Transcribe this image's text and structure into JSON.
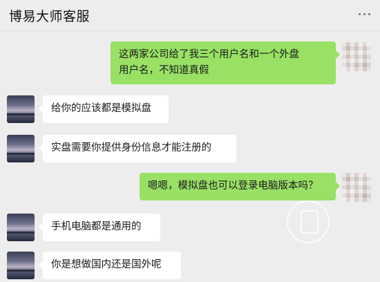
{
  "header": {
    "title": "博易大师客服",
    "more_icon": "ellipsis-icon"
  },
  "messages": [
    {
      "side": "out",
      "lines": [
        "这两家公司给了我三个用户名和一个外盘",
        "用户名，不知道真假"
      ]
    },
    {
      "side": "in",
      "text": "给你的应该都是模拟盘"
    },
    {
      "side": "in",
      "text": "实盘需要你提供身份信息才能注册的"
    },
    {
      "side": "out",
      "text": "嗯嗯，模拟盘也可以登录电脑版本吗？"
    },
    {
      "side": "in",
      "text": "手机电脑都是通用的"
    },
    {
      "side": "in",
      "text": "你是想做国内还是国外呢"
    }
  ],
  "colors": {
    "background": "#ededed",
    "sent_bubble": "#98e165",
    "received_bubble": "#ffffff"
  }
}
